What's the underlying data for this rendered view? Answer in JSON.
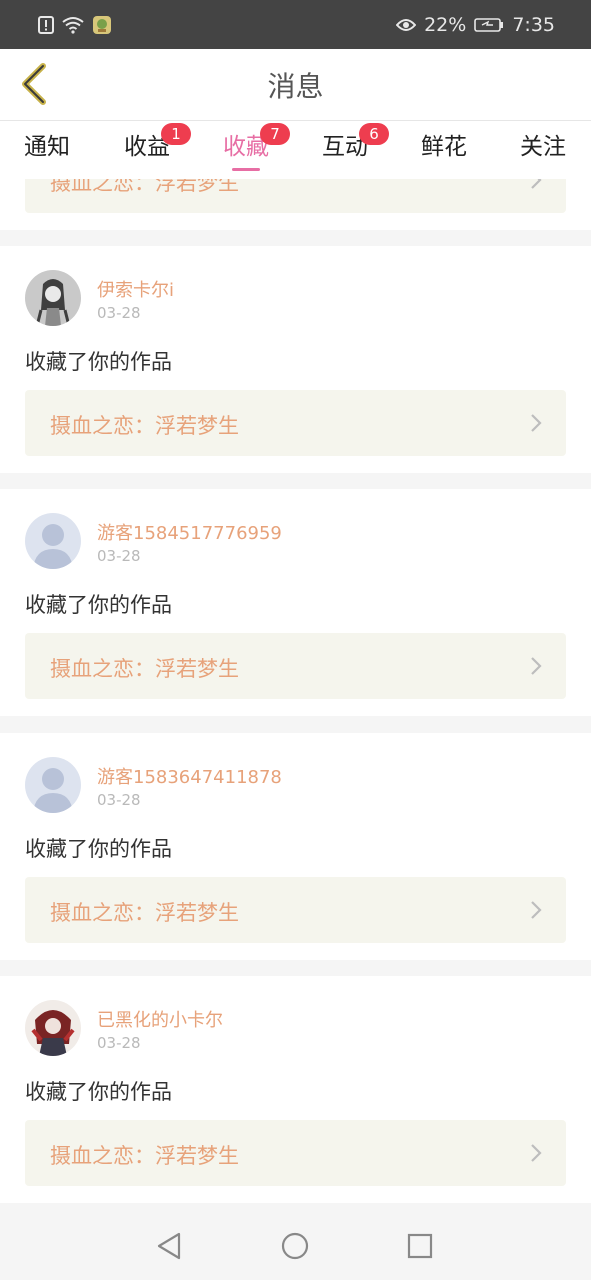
{
  "status_bar": {
    "battery": "22%",
    "time": "7:35",
    "icons": [
      "alert-icon",
      "wifi-icon",
      "app-notification-icon",
      "eye-icon",
      "battery-icon"
    ]
  },
  "header": {
    "title": "消息"
  },
  "tabs": [
    {
      "label": "通知",
      "badge": ""
    },
    {
      "label": "收益",
      "badge": "1"
    },
    {
      "label": "收藏",
      "badge": "7",
      "active": true
    },
    {
      "label": "互动",
      "badge": "6"
    },
    {
      "label": "鲜花",
      "badge": ""
    },
    {
      "label": "关注",
      "badge": ""
    }
  ],
  "partial_card": {
    "work_title": "摄血之恋：浮若梦生"
  },
  "items": [
    {
      "name": "伊索卡尔i",
      "date": "03-28",
      "action": "收藏了你的作品",
      "work_title": "摄血之恋：浮若梦生",
      "avatar": "anime-girl-avatar"
    },
    {
      "name": "游客1584517776959",
      "date": "03-28",
      "action": "收藏了你的作品",
      "work_title": "摄血之恋：浮若梦生",
      "avatar": "default-avatar"
    },
    {
      "name": "游客1583647411878",
      "date": "03-28",
      "action": "收藏了你的作品",
      "work_title": "摄血之恋：浮若梦生",
      "avatar": "default-avatar"
    },
    {
      "name": "已黑化的小卡尔",
      "date": "03-28",
      "action": "收藏了你的作品",
      "work_title": "摄血之恋：浮若梦生",
      "avatar": "dark-character-avatar"
    }
  ],
  "colors": {
    "accent": "#e76ea4",
    "name": "#e7a27a",
    "badge": "#ee3d4f",
    "work_bg": "#f5f5ed"
  }
}
